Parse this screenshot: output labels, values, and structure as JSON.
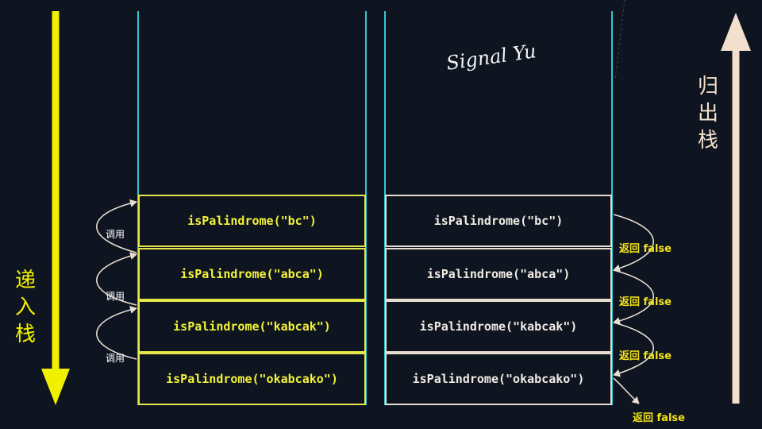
{
  "left_label": {
    "chars": [
      "递",
      "入",
      "栈"
    ],
    "color": "#f0f000"
  },
  "right_label": {
    "chars": [
      "归",
      "出",
      "栈"
    ],
    "color": "#f3e0cc"
  },
  "watermark": "Signal Yu",
  "push_stack": [
    "isPalindrome(\"bc\")",
    "isPalindrome(\"abca\")",
    "isPalindrome(\"kabcak\")",
    "isPalindrome(\"okabcako\")"
  ],
  "pop_stack": [
    "isPalindrome(\"bc\")",
    "isPalindrome(\"abca\")",
    "isPalindrome(\"kabcak\")",
    "isPalindrome(\"okabcako\")"
  ],
  "call_labels": [
    "调用",
    "调用",
    "调用"
  ],
  "return_labels": [
    "返回 false",
    "返回 false",
    "返回 false",
    "返回 false"
  ],
  "colors": {
    "background": "#0f1520",
    "stack_wall": "#35c6d0",
    "push_box": "#e6e64a",
    "pop_box": "#e6dccf",
    "return_text": "#f2e21a",
    "curve": "#e8ddd1"
  }
}
